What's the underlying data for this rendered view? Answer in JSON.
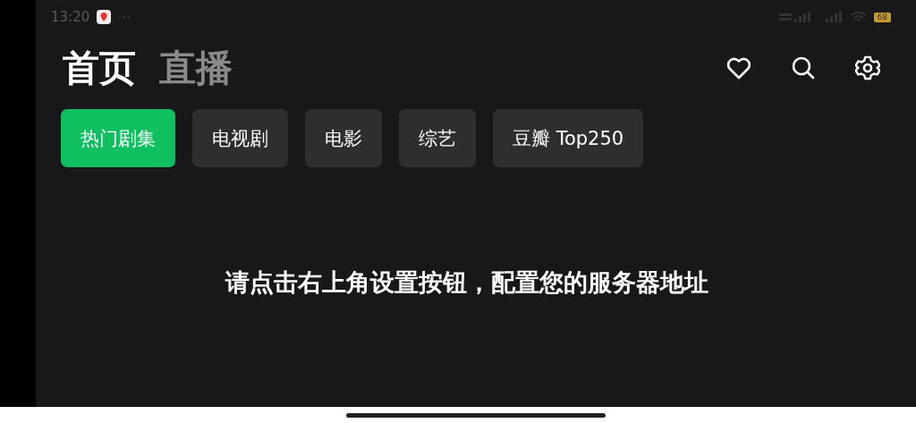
{
  "status_bar": {
    "time": "13:20",
    "battery": "68"
  },
  "tabs": [
    {
      "label": "首页",
      "selected": true
    },
    {
      "label": "直播",
      "selected": false
    }
  ],
  "categories": [
    {
      "label": "热门剧集",
      "selected": true
    },
    {
      "label": "电视剧",
      "selected": false
    },
    {
      "label": "电影",
      "selected": false
    },
    {
      "label": "综艺",
      "selected": false
    },
    {
      "label": "豆瓣 Top250",
      "selected": false
    }
  ],
  "message": "请点击右上角设置按钮，配置您的服务器地址"
}
